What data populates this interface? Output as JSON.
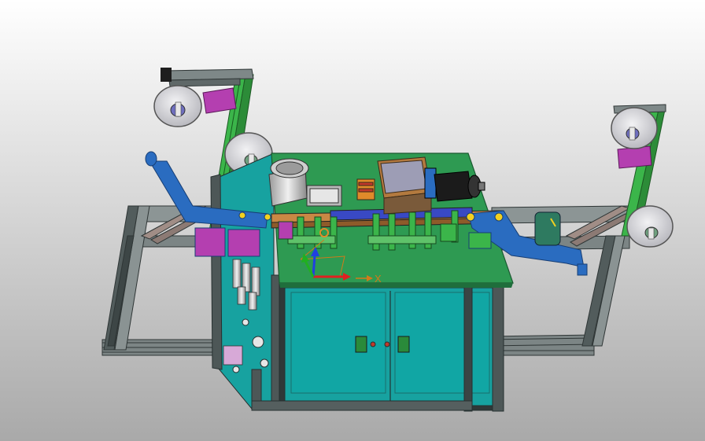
{
  "viewport": {
    "background_top": "#ffffff",
    "background_bottom": "#a9a9a9",
    "triad": {
      "x_axis_label": "X"
    }
  },
  "colors": {
    "frame": "#3f4a4a",
    "frame_light": "#8c9595",
    "table_top": "#2e9a52",
    "cabinet": "#17a2a0",
    "reel": "#d9d9dc",
    "green_upright": "#3bb54a",
    "blue_arm": "#2a6cc0",
    "magenta_bracket": "#b43fb0",
    "orange_part": "#e08a2a",
    "motor": "#1b1b1b",
    "copper_box": "#b37a3f",
    "triad_x": "#e02020",
    "triad_y": "#20b020",
    "triad_z": "#2040e0"
  }
}
